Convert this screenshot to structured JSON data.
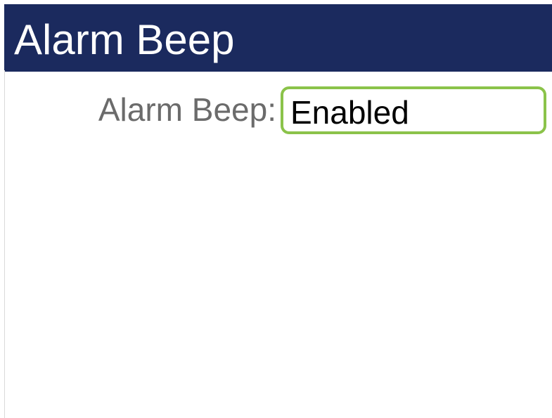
{
  "header": {
    "title": "Alarm Beep"
  },
  "settings": {
    "alarm_beep": {
      "label": "Alarm Beep:",
      "value": "Enabled"
    }
  },
  "colors": {
    "header_background": "#1b2a5e",
    "focus_border": "#8bc34a",
    "label_text": "#6b6b6b"
  }
}
